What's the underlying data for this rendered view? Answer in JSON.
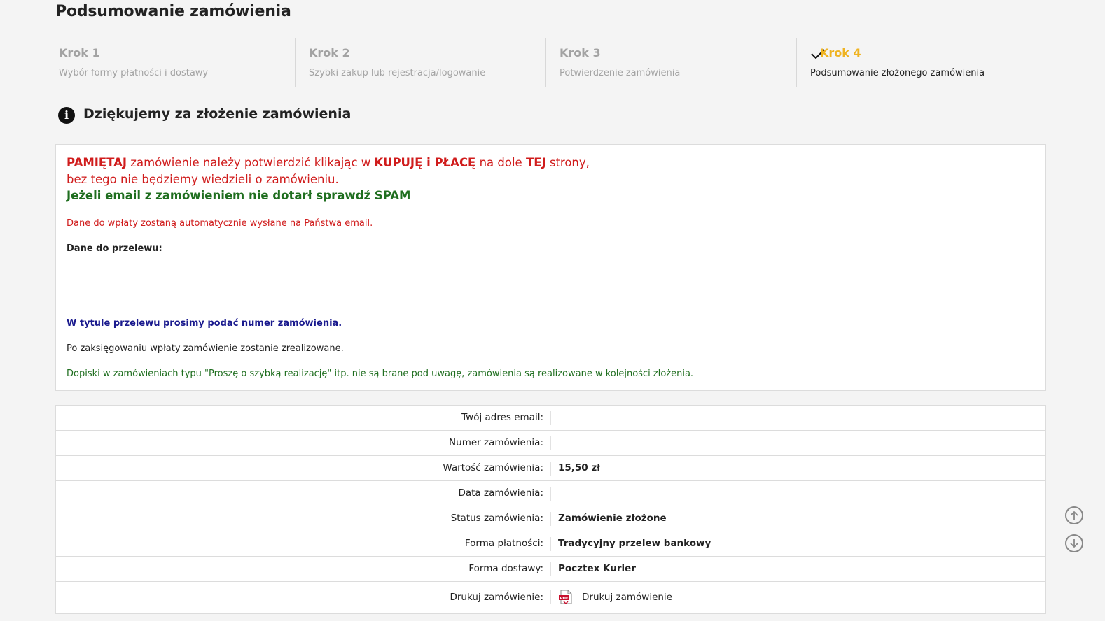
{
  "page": {
    "title": "Podsumowanie zamówienia"
  },
  "steps": [
    {
      "num": "Krok 1",
      "desc": "Wybór formy płatności i dostawy"
    },
    {
      "num": "Krok 2",
      "desc": "Szybki zakup lub rejestracja/logowanie"
    },
    {
      "num": "Krok 3",
      "desc": "Potwierdzenie zamówienia"
    },
    {
      "num": "Krok 4",
      "desc": "Podsumowanie złożonego zamówienia"
    }
  ],
  "colors": {
    "active_step": "#efb321",
    "warning": "#d01c1c",
    "success": "#1f6e1f",
    "info": "#1a1a8e"
  },
  "thanks": {
    "title": "Dziękujemy za złożenie zamówienia",
    "icon": "info-icon"
  },
  "notice": {
    "line1": {
      "p1": "PAMIĘTAJ",
      "p2": " zamówienie należy potwierdzić klikając w ",
      "p3": "KUPUJĘ i PŁACĘ",
      "p4": " na dole ",
      "p5": "TEJ",
      "p6": " strony,"
    },
    "line2": "bez tego nie będziemy wiedzieli o zamówieniu.",
    "line3": "Jeżeli email z zamówieniem nie dotarł sprawdź SPAM",
    "auto_email": "Dane do wpłaty zostaną automatycznie wysłane na Państwa email.",
    "transfer_heading": "Dane do przelewu:",
    "title_hint": "W tytule przelewu prosimy podać numer zamówienia.",
    "after_payment": "Po zaksięgowaniu wpłaty zamówienie zostanie zrealizowane.",
    "remarks": "Dopiski w zamówieniach typu \"Proszę o szybką realizację\" itp. nie są brane pod uwagę, zamówienia są realizowane w kolejności złożenia."
  },
  "details": {
    "email_label": "Twój adres email:",
    "number_label": "Numer zamówienia:",
    "value_label": "Wartość zamówienia:",
    "value": "15,50 zł",
    "date_label": "Data zamówienia:",
    "status_label": "Status zamówienia:",
    "status": "Zamówienie złożone",
    "payment_label": "Forma płatności:",
    "payment": "Tradycyjny przelew bankowy",
    "delivery_label": "Forma dostawy:",
    "delivery": "Pocztex Kurier",
    "print_label": "Drukuj zamówienie:",
    "print_link": "Drukuj zamówienie"
  },
  "scroll": {
    "up_icon": "arrow-up-circle-icon",
    "down_icon": "arrow-down-circle-icon"
  }
}
